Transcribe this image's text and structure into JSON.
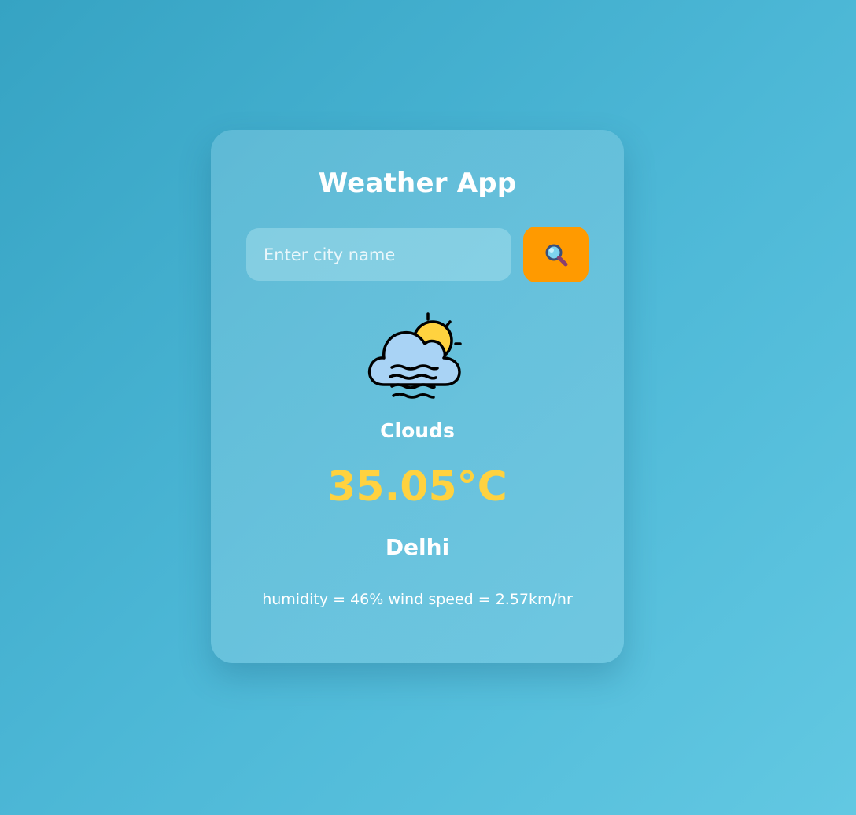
{
  "app": {
    "title": "Weather App"
  },
  "search": {
    "placeholder": "Enter city name",
    "value": "",
    "button_icon": "search-icon"
  },
  "weather": {
    "icon": "cloud-sun-wind-icon",
    "condition": "Clouds",
    "temperature": "35.05°C",
    "city": "Delhi",
    "details": "humidity = 46% wind speed = 2.57km/hr"
  },
  "colors": {
    "accent": "#ff9a00",
    "temperature": "#ffd23f",
    "text": "#ffffff"
  }
}
